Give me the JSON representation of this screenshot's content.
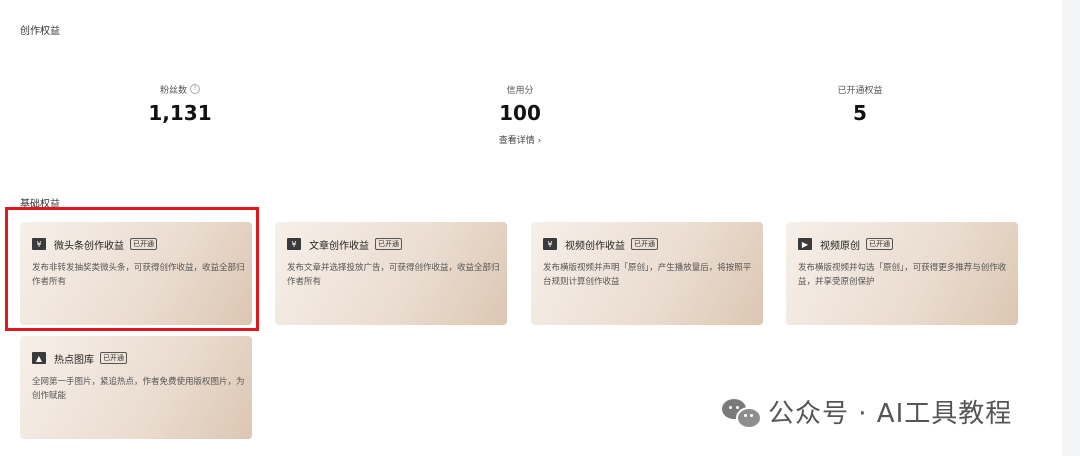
{
  "section": {
    "title": "创作权益"
  },
  "stats": [
    {
      "label": "粉丝数",
      "value": "1,131",
      "has_help": true
    },
    {
      "label": "信用分",
      "value": "100",
      "link": "查看详情 ›"
    },
    {
      "label": "已开通权益",
      "value": "5"
    }
  ],
  "subsection": {
    "title": "基础权益"
  },
  "cards": [
    {
      "icon": "yen-icon",
      "icon_glyph": "¥",
      "title": "微头条创作收益",
      "badge": "已开通",
      "desc": "发布非转发抽奖类微头条，可获得创作收益，收益全部归作者所有"
    },
    {
      "icon": "yen-icon",
      "icon_glyph": "¥",
      "title": "文章创作收益",
      "badge": "已开通",
      "desc": "发布文章并选择投放广告，可获得创作收益，收益全部归作者所有"
    },
    {
      "icon": "tv-yen-icon",
      "icon_glyph": "¥",
      "title": "视频创作收益",
      "badge": "已开通",
      "desc": "发布横版视频并声明「原创」，产生播放量后，将按照平台规则计算创作收益"
    },
    {
      "icon": "video-camera-icon",
      "icon_glyph": "▶",
      "title": "视频原创",
      "badge": "已开通",
      "desc": "发布横版视频并勾选「原创」，可获得更多推荐与创作收益，并享受原创保护"
    },
    {
      "icon": "image-icon",
      "icon_glyph": "▲",
      "title": "热点图库",
      "badge": "已开通",
      "desc": "全网第一手图片，紧追热点，作者免费使用版权图片，为创作赋能"
    }
  ],
  "watermark": {
    "text": "公众号 · AI工具教程"
  },
  "colors": {
    "highlight": "#e0191f",
    "card_start": "#f6f0ea",
    "card_end": "#dcc6b2"
  }
}
